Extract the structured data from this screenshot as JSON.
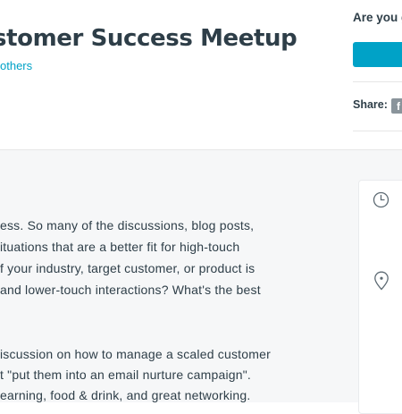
{
  "header": {
    "event_title": "stomer Success Meetup",
    "hosted_by": "others"
  },
  "rsvp": {
    "question": "Are you g",
    "share_label": "Share:",
    "share_icon_glyph": "f"
  },
  "description": {
    "lines": [
      "ess. So many of the discussions, blog posts,",
      "ituations that are a better fit for high-touch",
      "f your industry, target customer, or product is",
      " and lower-touch interactions? What's the best",
      "iscussion on how to manage a scaled customer",
      "t \"put them into an email nurture campaign\".",
      "earning, food & drink, and great networking."
    ]
  },
  "info_card": {
    "icons": [
      "clock-icon",
      "map-pin-icon"
    ]
  },
  "colors": {
    "accent": "#00a2c7",
    "text": "#2e3e48",
    "content_background": "#f6f7f8",
    "rule": "#e6e6e6"
  }
}
